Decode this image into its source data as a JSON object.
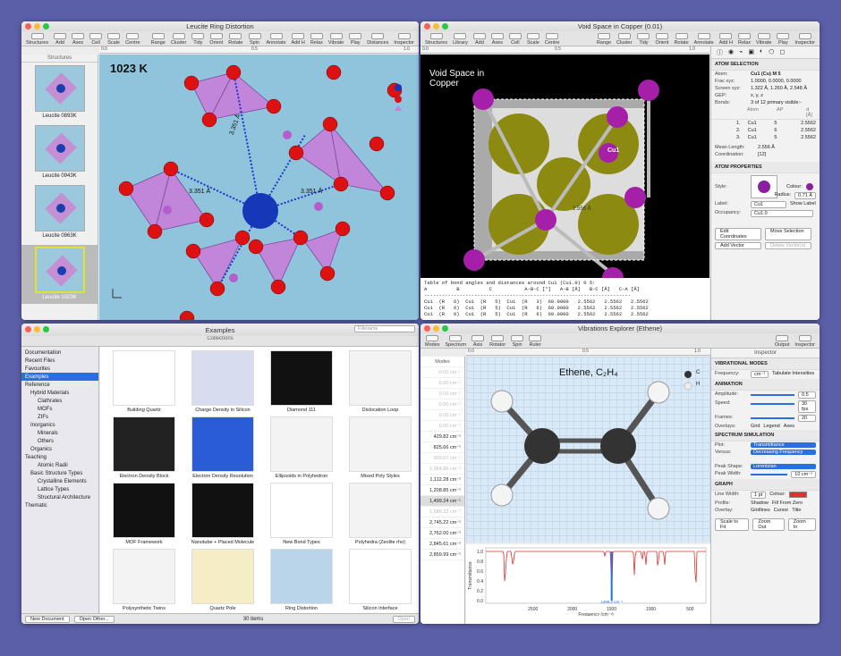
{
  "w1": {
    "title": "Leucite Ring Distortion",
    "toolbar": [
      "Structures",
      "Add",
      "Axes",
      "Cell",
      "Scale",
      "Centre",
      "Range",
      "Cluster",
      "Tidy",
      "Orient",
      "Rotate",
      "Spin",
      "Annotate",
      "Add H",
      "Relax",
      "Vibrate",
      "Play",
      "Distances",
      "Inspector"
    ],
    "sidebar_title": "Structures",
    "thumbs": [
      "Leucite 0893K",
      "Leucite 0943K",
      "Leucite 0963K",
      "Leucite 1023K"
    ],
    "temp": "1023 K",
    "dist": "3.351 Å",
    "ruler": [
      "0.0",
      "0.5",
      "1.0"
    ]
  },
  "w2": {
    "title": "Void Space in Copper (0.01)",
    "toolbar": [
      "Structures",
      "Library",
      "Add",
      "Axes",
      "Cell",
      "Scale",
      "Centre",
      "Range",
      "Cluster",
      "Tidy",
      "Orient",
      "Rotate",
      "Annotate",
      "Add H",
      "Relax",
      "Vibrate",
      "Play",
      "Inspector"
    ],
    "overlay": "Void Space in Copper",
    "atom_label": "Cu1",
    "dist": "2.556 Å",
    "atom_sel": {
      "head": "ATOM SELECTION",
      "atom_k": "Atom:",
      "atom": "Cu1 (Cu) M 5",
      "frac_k": "Frac xyz:",
      "frac": "1.0000, 0.0000, 0.0000",
      "screen_k": "Screen xyz:",
      "screen": "1.322 Å, 1.260 Å, 2.548 Å",
      "gep_k": "GEP:",
      "gep": "x, y, z",
      "bonds_k": "Bonds:",
      "bonds": "3 of 12 primary visible:-"
    },
    "bond_head": [
      "Atom",
      "AP",
      "d [Å]"
    ],
    "bond_rows": [
      [
        "1.",
        "Cu1",
        "5",
        "2.5562"
      ],
      [
        "2.",
        "Cu1",
        "6",
        "2.5562"
      ],
      [
        "3.",
        "Cu1",
        "5",
        "2.5562"
      ]
    ],
    "mean": "Mean Length:",
    "mean_v": "2.556 Å",
    "coord": "Coordination:",
    "coord_v": "[12]",
    "props": {
      "head": "ATOM PROPERTIES",
      "style": "Style:",
      "colour": "Colour:",
      "radius": "Radius:",
      "radius_v": "0.71 Å",
      "label": "Label:",
      "label_v": "Cu1",
      "show": "Show Label",
      "occ": "Occupancy:",
      "occ_v": "Cu1.0"
    },
    "btns": [
      "Edit Coordinates",
      "Move Selection",
      "Add Vector",
      "Delete Vector(s)"
    ],
    "table": "Table of bond angles and distances around Cu1 (Cu1.0) 0 5:\nA          B          C           A-B-C [°]   A-B [Å]   B-C [Å]   C-A [Å]\n----------------------------------------------------------------------\nCu1  (R   6)  Cu1  (R   5)  Cu1  (R   3)  60.0000   2.5562   2.5562   2.5562\nCu1  (R   6)  Cu1  (R   5)  Cu1  (R   6)  60.0000   2.5562   2.5562   2.5562\nCu1  (R   6)  Cu1  (R   5)  Cu1  (R   6)  60.0000   2.5562   2.5562   2.5562",
    "ruler": [
      "0.0",
      "0.5",
      "1.0"
    ]
  },
  "w3": {
    "title": "Examples",
    "search": "Filename",
    "sidebar_title": "Collections",
    "items": [
      "Documentation",
      "Recent Files",
      "Favourites",
      "Examples",
      "Reference",
      "Hybrid Materials",
      "Clathrates",
      "MOFs",
      "ZIFs",
      "Inorganics",
      "Minerals",
      "Others",
      "Organics",
      "Teaching",
      "Atomic Radii",
      "Basic Structure Types",
      "Crystalline Elements",
      "Lattice Types",
      "Structural Architecture",
      "Thematic"
    ],
    "tiles": [
      "Building Quartz",
      "Charge Density in Silicon",
      "Diamond 111",
      "Dislocation Loop",
      "Electron Density Block",
      "Electron Density Resolution",
      "Ellipsoids in Polyhedron",
      "Mixed Poly Styles",
      "MOF Framework",
      "Nanotube + Placed Molecule",
      "New Bond Types",
      "Polyhedra (Zeolite rho)",
      "Polysynthetic Twins",
      "Quartz Pole",
      "Ring Distortion",
      "Silicon Interface"
    ],
    "new": "New Document",
    "other": "Open Other...",
    "count": "30 items",
    "open": "Open"
  },
  "w4": {
    "title": "Vibrations Explorer (Ethene)",
    "toolbar": [
      "Modes",
      "Spectrum",
      "Axis",
      "Rotator",
      "Spin",
      "Ruler",
      "Output",
      "Inspector"
    ],
    "modes_head": "Modes",
    "modes": [
      "-0.00 cm⁻¹",
      "0.00 cm⁻¹",
      "0.00 cm⁻¹",
      "0.00 cm⁻¹",
      "0.00 cm⁻¹",
      "0.00 cm⁻¹",
      "429.82 cm⁻¹",
      "825.66 cm⁻¹",
      "909.67 cm⁻¹",
      "1,064.86 cm⁻¹",
      "1,112.28 cm⁻¹",
      "1,208.85 cm⁻¹",
      "1,499.24 cm⁻¹",
      "1,586.22 cm⁻¹",
      "2,745.22 cm⁻¹",
      "2,762.00 cm⁻¹",
      "2,845.61 cm⁻¹",
      "2,859.99 cm⁻¹"
    ],
    "label": "Ethene, C₂H₄",
    "c": "C",
    "h": "H",
    "insp": {
      "head": "Inspector",
      "vib": "VIBRATIONAL MODES",
      "freq": "Frequency:",
      "freq_v": "cm⁻¹",
      "tab": "Tabulate Intensities",
      "anim": "ANIMATION",
      "amp": "Amplitude:",
      "amp_v": "0.5",
      "speed": "Speed:",
      "speed_v": "30 fps",
      "frames": "Frames:",
      "frames_v": "20",
      "overlays": "Overlays:",
      "grid": "Grid",
      "legend": "Legend",
      "axes": "Axes",
      "spec": "SPECTRUM SIMULATION",
      "plot": "Plot:",
      "plot_v": "Transmittance",
      "versus": "Versus:",
      "versus_v": "Decreasing Frequency",
      "peak": "Peak Shape:",
      "peak_v": "Lorentzian",
      "width": "Peak Width:",
      "width_v": "10 cm⁻¹",
      "graph": "GRAPH",
      "lw": "Line Width:",
      "lw_v": "1 pt",
      "colour": "Colour:",
      "profile": "Profile:",
      "shadow": "Shadow",
      "fill": "Fill From Zero",
      "overlay": "Overlay:",
      "gridlines": "Gridlines",
      "cursor": "Cursor",
      "title": "Title",
      "b1": "Scale to Fit",
      "b2": "Zoom Out",
      "b3": "Zoom In"
    },
    "spectrum": {
      "ylabel": "Transmittance",
      "xlabel": "Frequency (cm⁻¹)",
      "xticks": [
        "2500",
        "2000",
        "1500",
        "1000",
        "500"
      ],
      "yticks": [
        "1.0",
        "0.8",
        "0.6",
        "0.4",
        "0.2",
        "0.0"
      ],
      "cursor": "1499.2 cm⁻¹"
    },
    "ruler": [
      "0.0",
      "0.5",
      "1.0"
    ]
  }
}
